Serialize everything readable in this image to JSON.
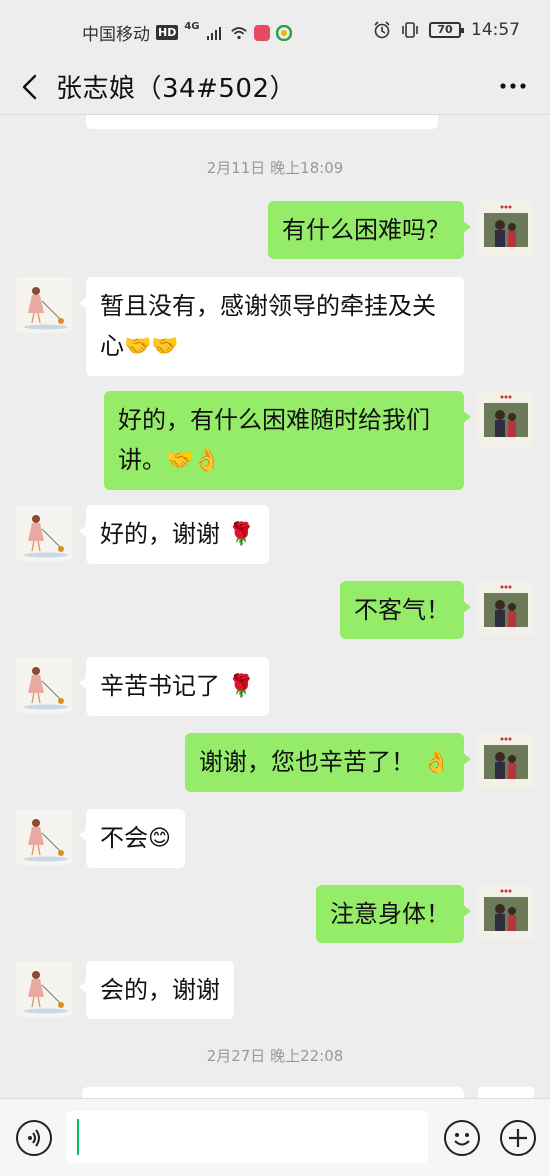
{
  "status_bar": {
    "carrier": "中国移动",
    "hd": "HD",
    "network": "4G",
    "battery": "70",
    "time": "14:57"
  },
  "header": {
    "title": "张志娘（34#502）"
  },
  "timestamps": [
    "2月11日 晚上18:09",
    "2月27日 晚上22:08"
  ],
  "messages": [
    {
      "side": "right",
      "text": "有什么困难吗？",
      "emoji": ""
    },
    {
      "side": "left",
      "text": "暂且没有，感谢领导的牵挂及关心",
      "emoji": "🤝🤝"
    },
    {
      "side": "right",
      "text": "好的，有什么困难随时给我们讲。",
      "emoji": "🤝👌"
    },
    {
      "side": "left",
      "text": "好的，谢谢",
      "emoji": "🌹"
    },
    {
      "side": "right",
      "text": "不客气！",
      "emoji": ""
    },
    {
      "side": "left",
      "text": "辛苦书记了",
      "emoji": "🌹"
    },
    {
      "side": "right",
      "text": "谢谢，您也辛苦了！",
      "emoji": "👌"
    },
    {
      "side": "left",
      "text": "不会",
      "emoji": "😊"
    },
    {
      "side": "right",
      "text": "注意身体！",
      "emoji": ""
    },
    {
      "side": "left",
      "text": "会的，谢谢",
      "emoji": ""
    }
  ],
  "input": {
    "value": "",
    "placeholder": ""
  },
  "icons": {
    "back": "back-arrow-icon",
    "more": "more-icon",
    "voice": "voice-icon",
    "emoji": "emoji-icon",
    "plus": "plus-icon"
  },
  "colors": {
    "my_bubble": "#95ec69",
    "other_bubble": "#ffffff",
    "background": "#ededed",
    "cursor": "#07c160"
  }
}
